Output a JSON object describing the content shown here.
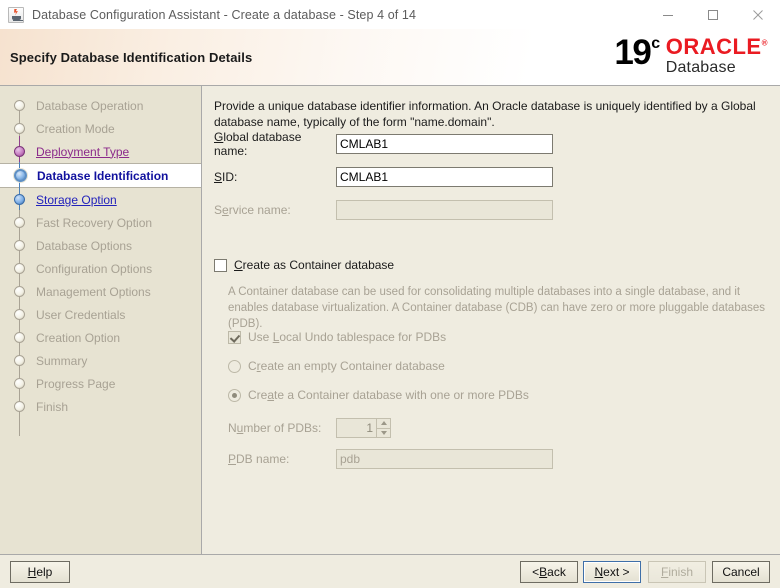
{
  "window": {
    "title": "Database Configuration Assistant - Create a database - Step 4 of 14",
    "icon": "java-cup-icon",
    "controls": {
      "minimize": "minimize-icon",
      "maximize": "maximize-icon",
      "close": "close-icon"
    }
  },
  "banner": {
    "title": "Specify Database Identification Details",
    "logo": {
      "version": "19",
      "version_sup": "c",
      "brand": "ORACLE",
      "registered": "®",
      "product": "Database"
    }
  },
  "sidebar": {
    "items": [
      {
        "label": "Database Operation",
        "state": "pending",
        "node": "pending"
      },
      {
        "label": "Creation Mode",
        "state": "pending",
        "node": "pending"
      },
      {
        "label": "Deployment Type",
        "state": "visited",
        "node": "done"
      },
      {
        "label": "Database Identification",
        "state": "current",
        "node": "current"
      },
      {
        "label": "Storage Option",
        "state": "link",
        "node": "blue"
      },
      {
        "label": "Fast Recovery Option",
        "state": "pending",
        "node": "pending"
      },
      {
        "label": "Database Options",
        "state": "pending",
        "node": "pending"
      },
      {
        "label": "Configuration Options",
        "state": "pending",
        "node": "pending"
      },
      {
        "label": "Management Options",
        "state": "pending",
        "node": "pending"
      },
      {
        "label": "User Credentials",
        "state": "pending",
        "node": "pending"
      },
      {
        "label": "Creation Option",
        "state": "pending",
        "node": "pending"
      },
      {
        "label": "Summary",
        "state": "pending",
        "node": "pending"
      },
      {
        "label": "Progress Page",
        "state": "pending",
        "node": "pending"
      },
      {
        "label": "Finish",
        "state": "pending",
        "node": "pending"
      }
    ]
  },
  "main": {
    "description": "Provide a unique database identifier information. An Oracle database is uniquely identified by a Global database name, typically of the form \"name.domain\".",
    "fields": {
      "global_db_name": {
        "label": "Global database name:",
        "value": "CMLAB1",
        "enabled": true
      },
      "sid": {
        "label": "SID:",
        "value": "CMLAB1",
        "enabled": true
      },
      "service_name": {
        "label": "Service name:",
        "value": "",
        "enabled": false
      }
    },
    "container": {
      "checkbox_label": "Create as Container database",
      "checked": false,
      "description": "A Container database can be used for consolidating multiple databases into a single database, and it enables database virtualization. A Container database (CDB) can have zero or more pluggable databases (PDB).",
      "local_undo": {
        "label": "Use Local Undo tablespace for PDBs",
        "checked": true,
        "enabled": false
      },
      "radio_empty": {
        "label": "Create an empty Container database",
        "selected": false,
        "enabled": false
      },
      "radio_with_pdbs": {
        "label": "Create a Container database with one or more PDBs",
        "selected": true,
        "enabled": false
      },
      "num_pdbs": {
        "label": "Number of PDBs:",
        "value": "1",
        "enabled": false
      },
      "pdb_name": {
        "label": "PDB name:",
        "value": "pdb",
        "enabled": false
      }
    }
  },
  "buttons": {
    "help": {
      "label": "Help",
      "enabled": true,
      "focused": false
    },
    "back": {
      "label": "< Back",
      "enabled": true,
      "focused": false
    },
    "next": {
      "label": "Next >",
      "enabled": true,
      "focused": true
    },
    "finish": {
      "label": "Finish",
      "enabled": false,
      "focused": false
    },
    "cancel": {
      "label": "Cancel",
      "enabled": true,
      "focused": false
    }
  },
  "colors": {
    "banner_accent": "#f6e2cf",
    "oracle_red": "#ea1b22",
    "sidebar_bg": "#e7e3d2",
    "panel_bg": "#efece0",
    "link": "#2222bb",
    "visited_link": "#8b2a8b",
    "current_step": "#11119e",
    "focus_border": "#3f6fa8"
  }
}
